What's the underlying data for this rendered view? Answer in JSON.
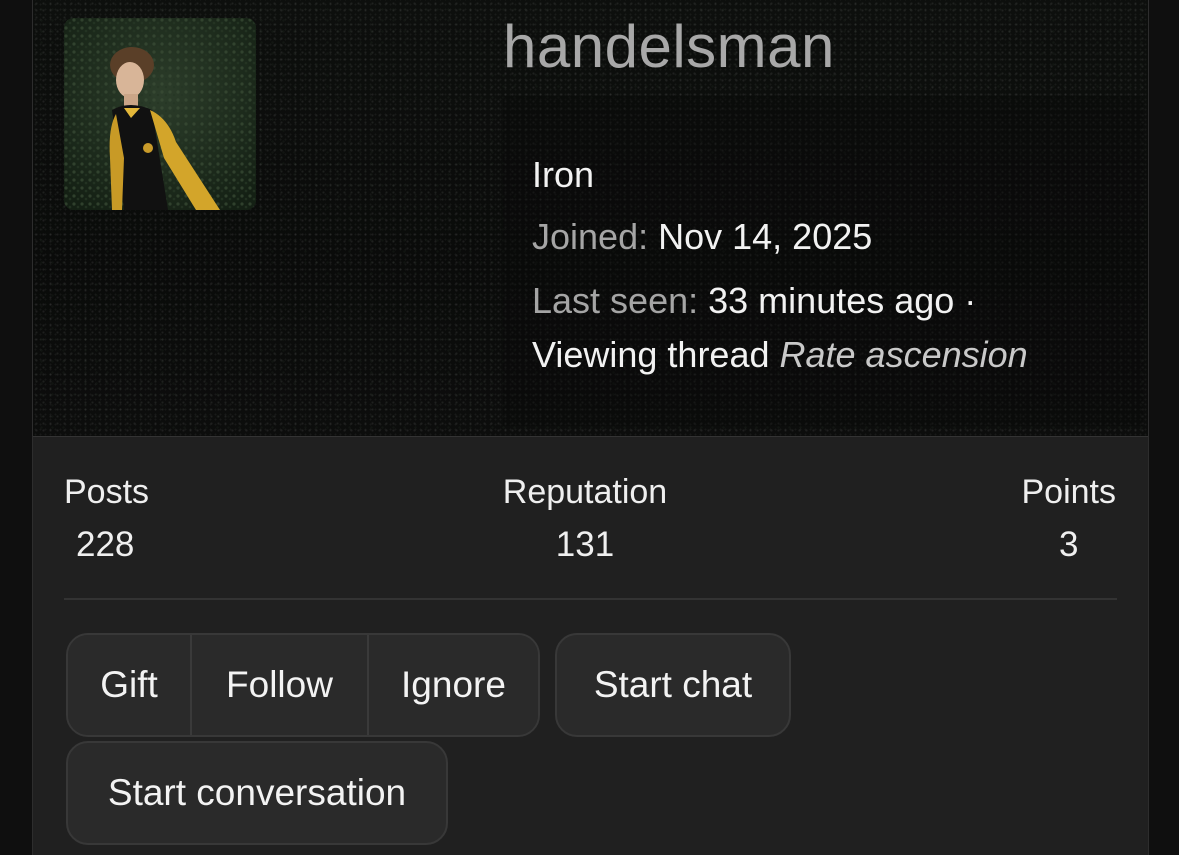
{
  "profile": {
    "username": "handelsman",
    "rank": "Iron",
    "joined_label": "Joined:",
    "joined_value": "Nov 14, 2025",
    "last_seen_label": "Last seen:",
    "last_seen_value": "33 minutes ago ·",
    "activity_prefix": "Viewing thread",
    "activity_thread": "Rate ascension",
    "avatar_icon": "user-avatar-photo"
  },
  "stats": {
    "posts_label": "Posts",
    "posts_value": "228",
    "reputation_label": "Reputation",
    "reputation_value": "131",
    "points_label": "Points",
    "points_value": "3"
  },
  "actions": {
    "gift": "Gift",
    "follow": "Follow",
    "ignore": "Ignore",
    "start_chat": "Start chat",
    "start_conversation": "Start conversation"
  },
  "colors": {
    "card_bg": "#202020",
    "button_bg": "#2a2a2a",
    "username": "#a8a8a8",
    "muted_text": "#a5a5a5"
  }
}
